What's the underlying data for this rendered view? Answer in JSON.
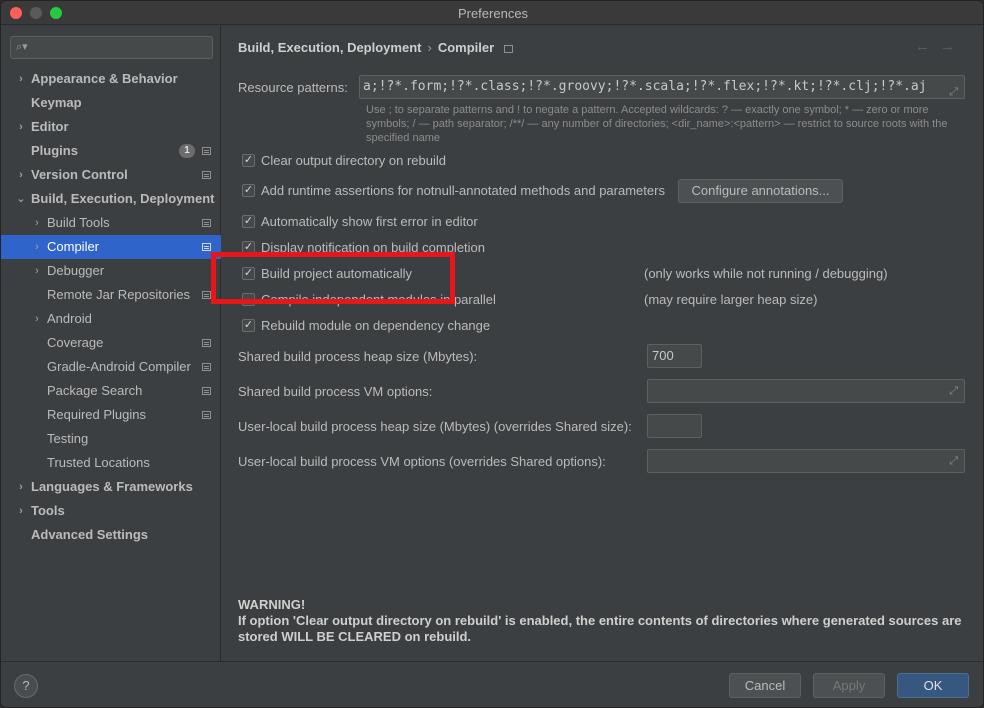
{
  "window": {
    "title": "Preferences"
  },
  "sidebar": {
    "items": [
      {
        "label": "Appearance & Behavior",
        "level": 0,
        "arrow": "›",
        "bold": true
      },
      {
        "label": "Keymap",
        "level": 0,
        "arrow": "",
        "bold": true
      },
      {
        "label": "Editor",
        "level": 0,
        "arrow": "›",
        "bold": true
      },
      {
        "label": "Plugins",
        "level": 0,
        "arrow": "",
        "bold": true,
        "badge": "1",
        "pinned": true
      },
      {
        "label": "Version Control",
        "level": 0,
        "arrow": "›",
        "bold": true,
        "pinned": true
      },
      {
        "label": "Build, Execution, Deployment",
        "level": 0,
        "arrow": "⌄",
        "bold": true
      },
      {
        "label": "Build Tools",
        "level": 1,
        "arrow": "›",
        "pinned": true
      },
      {
        "label": "Compiler",
        "level": 1,
        "arrow": "›",
        "pinned": true,
        "selected": true
      },
      {
        "label": "Debugger",
        "level": 1,
        "arrow": "›"
      },
      {
        "label": "Remote Jar Repositories",
        "level": 1,
        "arrow": "",
        "pinned": true
      },
      {
        "label": "Android",
        "level": 1,
        "arrow": "›"
      },
      {
        "label": "Coverage",
        "level": 1,
        "arrow": "",
        "pinned": true
      },
      {
        "label": "Gradle-Android Compiler",
        "level": 1,
        "arrow": "",
        "pinned": true
      },
      {
        "label": "Package Search",
        "level": 1,
        "arrow": "",
        "pinned": true
      },
      {
        "label": "Required Plugins",
        "level": 1,
        "arrow": "",
        "pinned": true
      },
      {
        "label": "Testing",
        "level": 1,
        "arrow": ""
      },
      {
        "label": "Trusted Locations",
        "level": 1,
        "arrow": ""
      },
      {
        "label": "Languages & Frameworks",
        "level": 0,
        "arrow": "›",
        "bold": true
      },
      {
        "label": "Tools",
        "level": 0,
        "arrow": "›",
        "bold": true
      },
      {
        "label": "Advanced Settings",
        "level": 0,
        "arrow": "",
        "bold": true
      }
    ]
  },
  "breadcrumb": {
    "parent": "Build, Execution, Deployment",
    "separator": "›",
    "current": "Compiler"
  },
  "resource_patterns": {
    "label": "Resource patterns:",
    "value": "a;!?*.form;!?*.class;!?*.groovy;!?*.scala;!?*.flex;!?*.kt;!?*.clj;!?*.aj",
    "hint_line1": "Use ; to separate patterns and ! to negate a pattern. Accepted wildcards: ? — exactly one symbol; * — zero or more",
    "hint_line2": "symbols; / — path separator; /**/ — any number of directories; <dir_name>:<pattern> — restrict to source roots with the",
    "hint_line3": "specified name"
  },
  "options": {
    "clear_output": {
      "label": "Clear output directory on rebuild",
      "checked": true
    },
    "runtime_assertions": {
      "label": "Add runtime assertions for notnull-annotated methods and parameters",
      "checked": true
    },
    "configure_annotations": "Configure annotations...",
    "show_first_error": {
      "label": "Automatically show first error in editor",
      "checked": true
    },
    "display_notification": {
      "label": "Display notification on build completion",
      "checked": true
    },
    "build_automatically": {
      "label": "Build project automatically",
      "checked": true,
      "note": "(only works while not running / debugging)"
    },
    "compile_parallel": {
      "label": "Compile independent modules in parallel",
      "checked": false,
      "note": "(may require larger heap size)"
    },
    "rebuild_on_dependency": {
      "label": "Rebuild module on dependency change",
      "checked": true
    }
  },
  "fields": {
    "shared_heap": {
      "label": "Shared build process heap size (Mbytes):",
      "value": "700"
    },
    "shared_vm": {
      "label": "Shared build process VM options:",
      "value": ""
    },
    "user_heap": {
      "label": "User-local build process heap size (Mbytes) (overrides Shared size):",
      "value": ""
    },
    "user_vm": {
      "label": "User-local build process VM options (overrides Shared options):",
      "value": ""
    }
  },
  "warning": {
    "title": "WARNING!",
    "text": "If option 'Clear output directory on rebuild' is enabled, the entire contents of directories where generated sources are stored WILL BE CLEARED on rebuild."
  },
  "footer": {
    "help": "?",
    "cancel": "Cancel",
    "apply": "Apply",
    "ok": "OK"
  },
  "colors": {
    "accent": "#2f65ca",
    "highlight_box": "#e8151b",
    "primary_button": "#365880"
  }
}
